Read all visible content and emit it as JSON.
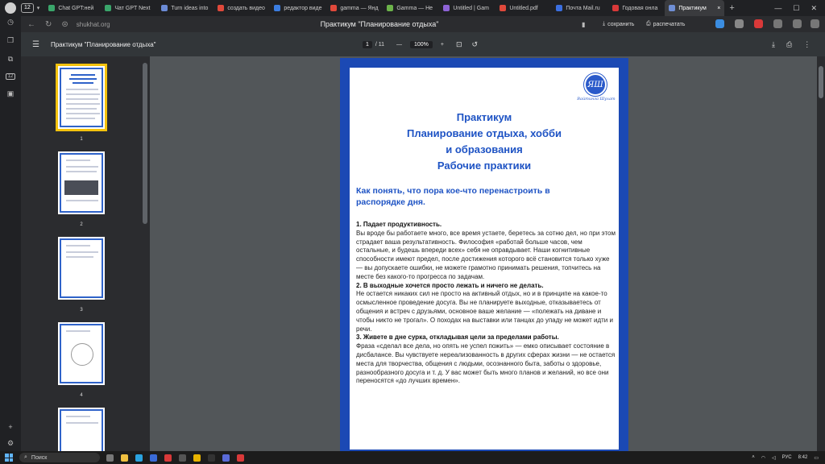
{
  "tabs": {
    "count": "12",
    "items": [
      {
        "label": "Chat GPT:ней",
        "color": "#3aa66b"
      },
      {
        "label": "Чат GPT Next",
        "color": "#3aa66b"
      },
      {
        "label": "Turn ideas into",
        "color": "#6b8bd6"
      },
      {
        "label": "создать видео",
        "color": "#e0493b"
      },
      {
        "label": "редактор виде",
        "color": "#3b7de0"
      },
      {
        "label": "gamma — Янд",
        "color": "#e0493b"
      },
      {
        "label": "Gamma — He",
        "color": "#6cb34a"
      },
      {
        "label": "Untitled | Gam",
        "color": "#8e63d6"
      },
      {
        "label": "Untitled.pdf",
        "color": "#e0493b"
      },
      {
        "label": "Почта Mail.ru",
        "color": "#3b6fe0"
      },
      {
        "label": "Годовая онла",
        "color": "#d93939"
      }
    ],
    "active_label": "Практикум",
    "close_glyph": "×",
    "new_tab_glyph": "+"
  },
  "address": {
    "domain": "shukhat.org",
    "page_title": "Практикум \"Планирование отдыха\"",
    "save_label": "сохранить",
    "print_label": "распечатать"
  },
  "pdf_toolbar": {
    "file_title": "Практикум \"Планирование отдыха\"",
    "current_page": "1",
    "total_pages": "/ 11",
    "zoom": "100%",
    "zoom_out": "—",
    "zoom_in": "+"
  },
  "thumbnails": [
    "1",
    "2",
    "3",
    "4"
  ],
  "document": {
    "logo_initials": "ЯШ",
    "logo_text": "Вайтинга Шухат",
    "title_lines": [
      "Практикум",
      "Планирование отдыха, хобби",
      "и образования",
      "Рабочие практики"
    ],
    "subtitle": "Как понять, что пора кое-что перенастроить в распорядке дня.",
    "sections": [
      {
        "heading": "1. Падает продуктивность.",
        "text": "Вы вроде бы работаете много, все время устаете, беретесь за сотню дел, но при этом страдает ваша результативность. Философия «работай больше часов, чем остальные, и будешь впереди всех» себя не оправдывает. Наши когнитивные способности имеют предел, после достижения которого всё становится только хуже — вы допускаете ошибки, не можете грамотно принимать решения, топчитесь на месте без какого-то прогресса по задачам."
      },
      {
        "heading": "2. В выходные хочется просто лежать и ничего не делать.",
        "text": "Не остается никаких сил не просто на активный отдых, но и в принципе на какое-то осмысленное проведение досуга. Вы не планируете выходные, отказываетесь от общения и встреч с друзьями, основное ваше желание — «полежать на диване и чтобы никто не трогал». О походах на выставки или танцах до упаду не может идти и речи."
      },
      {
        "heading": "3. Живете в дне сурка, откладывая цели за пределами работы.",
        "text": "Фраза «сделал все дела, но опять не успел пожить» — емко описывает состояние в дисбалансе. Вы чувствуете нереализованность в других сферах жизни — не остается места для творчества, общения с людьми, осознанного быта, заботы о здоровье, разнообразного досуга и т. д. У вас может быть много планов и желаний, но все они переносятся «до лучших времен»."
      }
    ]
  },
  "taskbar": {
    "search_label": "Поиск",
    "lang": "РУС",
    "time": "8:42"
  }
}
